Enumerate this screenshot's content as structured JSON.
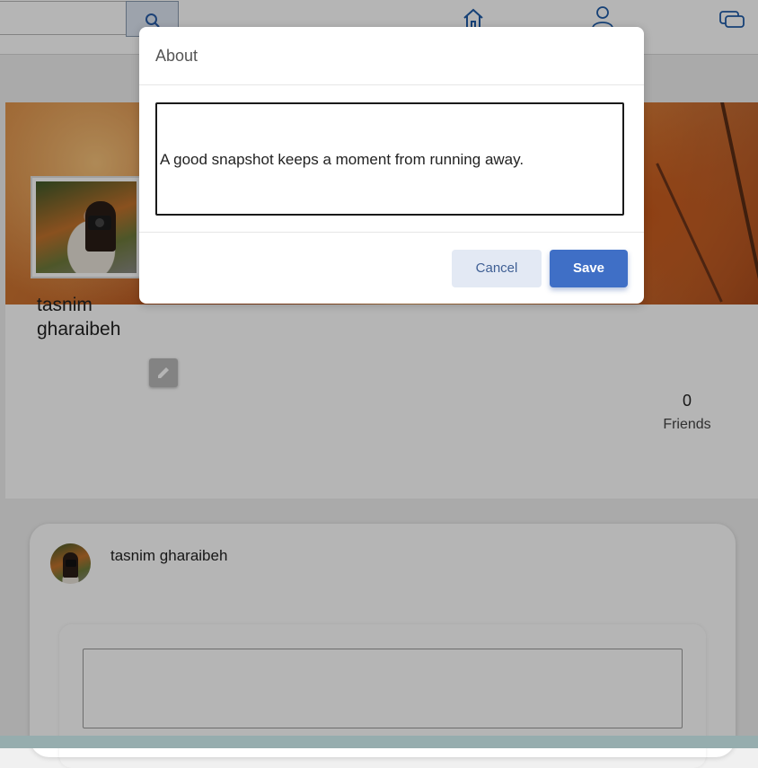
{
  "header": {
    "search": {
      "value": "",
      "icon": "search-icon"
    },
    "nav": [
      {
        "id": "home",
        "icon": "home-icon"
      },
      {
        "id": "friends",
        "icon": "friends-icon"
      },
      {
        "id": "messages",
        "icon": "messages-icon"
      }
    ]
  },
  "profile": {
    "name": "tasnim gharaibeh",
    "friends_count": "0",
    "friends_label": "Friends",
    "edit_icon": "pencil-icon"
  },
  "post_composer": {
    "author": "tasnim gharaibeh",
    "text_value": ""
  },
  "modal": {
    "title": "About",
    "about_text": "A good snapshot keeps a moment from running away.",
    "cancel_label": "Cancel",
    "save_label": "Save"
  },
  "colors": {
    "accent": "#3f6fc6",
    "cancel_bg": "#e3e9f4",
    "overlay": "rgba(0,0,0,0.29)"
  }
}
